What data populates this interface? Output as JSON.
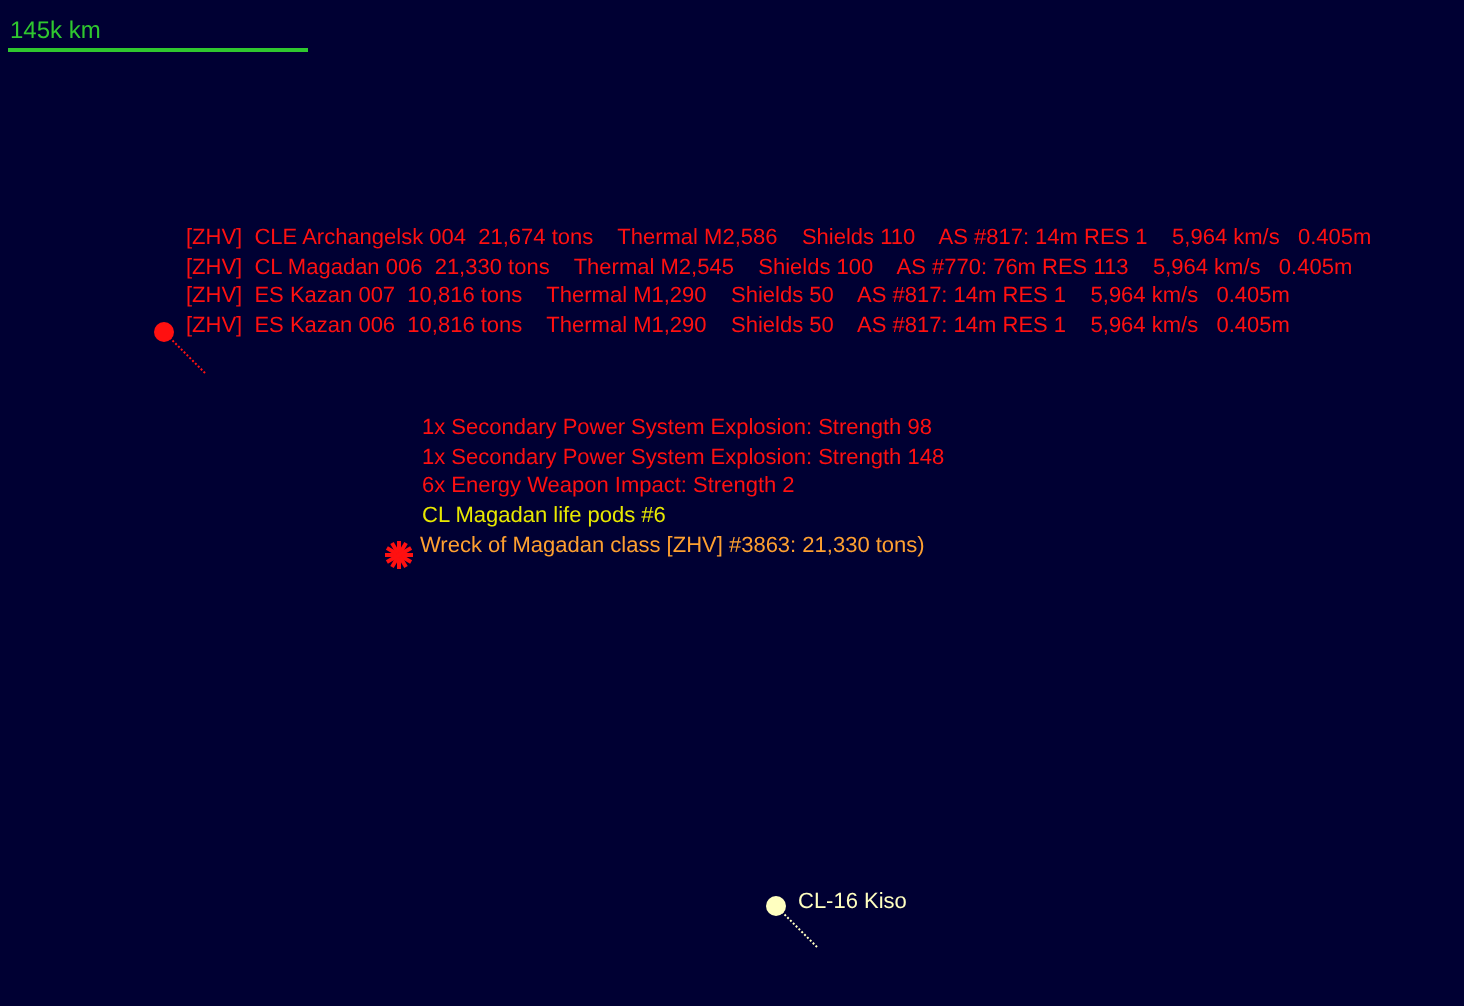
{
  "scale": {
    "label": "145k km"
  },
  "contacts": [
    {
      "kind": "ship",
      "color": "#ff1010",
      "lines": [
        "[ZHV]  CLE Archangelsk 004  21,674 tons    Thermal M2,586    Shields 110    AS #817: 14m RES 1    5,964 km/s   0.405m",
        "[ZHV]  CL Magadan 006  21,330 tons    Thermal M2,545    Shields 100    AS #770: 76m RES 113    5,964 km/s   0.405m",
        "[ZHV]  ES Kazan 007  10,816 tons    Thermal M1,290    Shields 50    AS #817: 14m RES 1    5,964 km/s   0.405m",
        "[ZHV]  ES Kazan 006  10,816 tons    Thermal M1,290    Shields 50    AS #817: 14m RES 1    5,964 km/s   0.405m"
      ]
    },
    {
      "kind": "wreck",
      "color": "#ff1010"
    },
    {
      "kind": "ship",
      "color": "#ffffc0",
      "lines": [
        "CL-16 Kiso"
      ]
    }
  ],
  "events": [
    {
      "text": "1x Secondary Power System Explosion: Strength 98",
      "color": "#ff1010"
    },
    {
      "text": "1x Secondary Power System Explosion: Strength 148",
      "color": "#ff1010"
    },
    {
      "text": "6x Energy Weapon Impact: Strength 2",
      "color": "#ff1010"
    },
    {
      "text": "CL Magadan life pods #6",
      "color": "#e8e800"
    },
    {
      "text": "Wreck of Magadan class [ZHV] #3863: 21,330 tons)",
      "color": "#ffa030"
    }
  ]
}
